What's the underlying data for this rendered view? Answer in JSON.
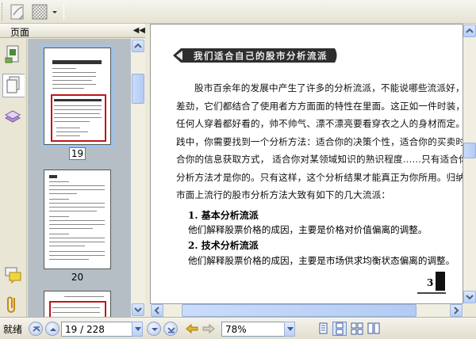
{
  "toolbar": {
    "buttons": [
      {
        "name": "snapshot-tool",
        "icon": "page-curl-icon"
      },
      {
        "name": "background-tool",
        "icon": "checkerboard-icon"
      }
    ],
    "dropdown_icon": "chevron-down-icon"
  },
  "left_panel": {
    "title": "页面",
    "collapse_icon": "double-chevron-left-icon",
    "side_tabs": [
      {
        "name": "bookmarks",
        "icon": "bookmark-icon"
      },
      {
        "name": "pages",
        "icon": "pages-icon",
        "active": true
      },
      {
        "name": "layers",
        "icon": "layers-icon"
      },
      {
        "name": "comments",
        "icon": "comment-icon"
      },
      {
        "name": "attachments",
        "icon": "paperclip-icon"
      }
    ],
    "thumbnails": [
      {
        "label": "19",
        "selected": true
      },
      {
        "label": "20",
        "selected": false
      }
    ]
  },
  "document": {
    "banner_text": "我们适合自己的股市分析流派",
    "paragraph_lines": [
      "股市百余年的发展中产生了许多的分析流派，不能说哪些流派好，哪些",
      "差劲，它们都结合了使用者方方面面的特性在里面。这正如一件时装，不是",
      "任何人穿着都好看的，帅不帅气、漂不漂亮要看穿衣之人的身材而定。在实",
      "践中，你需要找到一个分析方法：适合你的决策个性，适合你的买卖时间，适",
      "合你的信息获取方式， 适合你对某领域知识的熟识程度……只有适合你的",
      "分析方法才是你的。只有这样，这个分析结果才能真正为你所用。归纳起来，",
      "市面上流行的股市分析方法大致有如下的几大流派："
    ],
    "sections": [
      {
        "heading": "1. 基本分析流派",
        "body": "他们解释股票价格的成因，主要是价格对价值偏离的调整。"
      },
      {
        "heading": "2. 技术分析流派",
        "body": "他们解释股票价格的成因，主要是市场供求均衡状态偏离的调整。"
      }
    ],
    "page_number": "3"
  },
  "statusbar": {
    "status": "就绪",
    "page_field": "19 / 228",
    "zoom_field": "78%",
    "nav_icons": [
      "first-page-icon",
      "previous-page-icon",
      "next-page-icon",
      "last-page-icon"
    ],
    "history_icons": [
      "back-arrow-icon",
      "forward-arrow-icon"
    ],
    "view_icons": [
      "single-page-icon",
      "continuous-icon",
      "facing-icon",
      "continuous-facing-icon"
    ]
  },
  "colors": {
    "chrome": "#ece9d8",
    "thumb_bg": "#b6bec5",
    "selection_border": "#3c7fd9",
    "highlight_box": "#c0161c"
  }
}
